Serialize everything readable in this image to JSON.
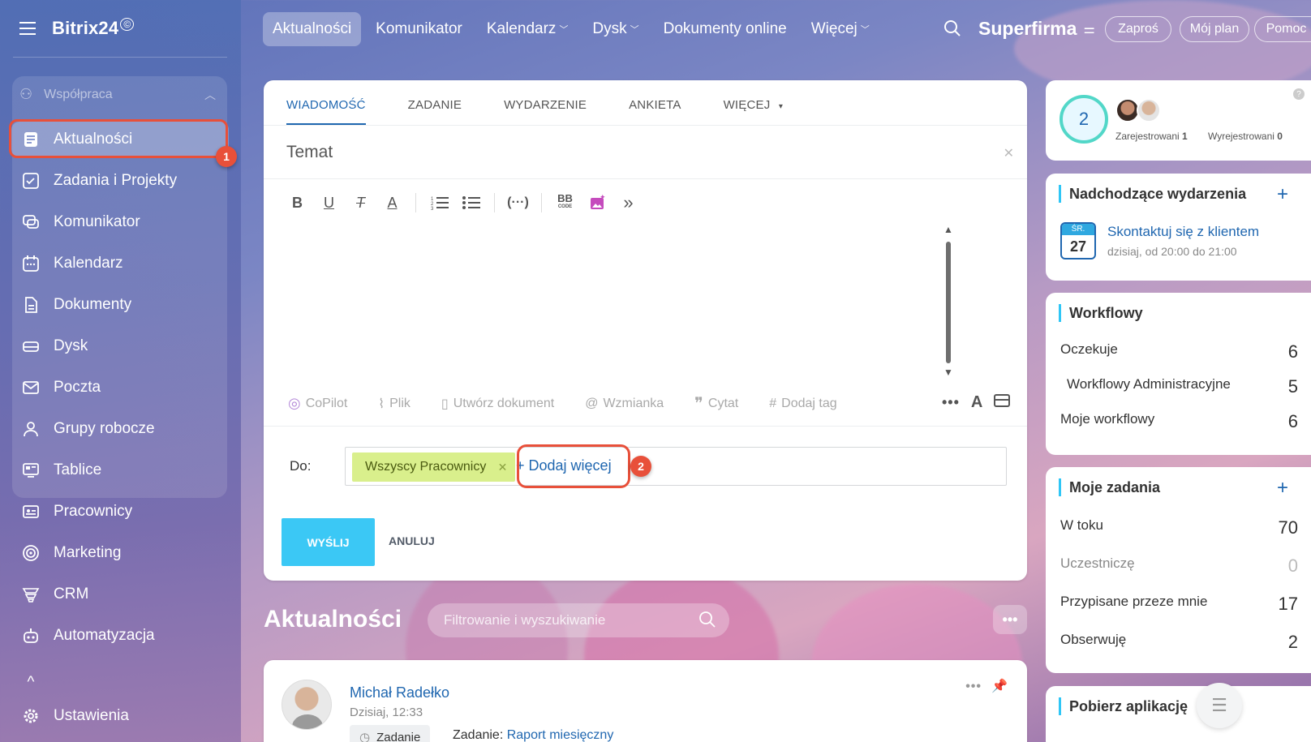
{
  "app": {
    "logo": "Bitrix24",
    "logo_mark": "©",
    "company": "Superfirma"
  },
  "topnav": {
    "items": [
      {
        "label": "Aktualności",
        "active": true
      },
      {
        "label": "Komunikator"
      },
      {
        "label": "Kalendarz",
        "dropdown": true
      },
      {
        "label": "Dysk",
        "dropdown": true
      },
      {
        "label": "Dokumenty online"
      },
      {
        "label": "Więcej",
        "dropdown": true
      }
    ],
    "invite": "Zaproś",
    "plan": "Mój plan",
    "help": "Pomoc"
  },
  "sidebar": {
    "group": "Współpraca",
    "items": [
      {
        "label": "Aktualności",
        "icon": "news-icon",
        "active": true
      },
      {
        "label": "Zadania i Projekty",
        "icon": "tasks-icon"
      },
      {
        "label": "Komunikator",
        "icon": "chat-icon"
      },
      {
        "label": "Kalendarz",
        "icon": "calendar-icon"
      },
      {
        "label": "Dokumenty",
        "icon": "document-icon"
      },
      {
        "label": "Dysk",
        "icon": "drive-icon"
      },
      {
        "label": "Poczta",
        "icon": "mail-icon"
      },
      {
        "label": "Grupy robocze",
        "icon": "groups-icon"
      },
      {
        "label": "Tablice",
        "icon": "boards-icon"
      },
      {
        "label": "Pracownicy",
        "icon": "employees-icon"
      },
      {
        "label": "Marketing",
        "icon": "marketing-icon"
      },
      {
        "label": "CRM",
        "icon": "crm-icon"
      },
      {
        "label": "Automatyzacja",
        "icon": "automation-icon"
      }
    ],
    "settings": "Ustawienia"
  },
  "composer": {
    "tabs": [
      "WIADOMOŚĆ",
      "ZADANIE",
      "WYDARZENIE",
      "ANKIETA",
      "WIĘCEJ"
    ],
    "subject_placeholder": "Temat",
    "actions": [
      "CoPilot",
      "Plik",
      "Utwórz dokument",
      "Wzmianka",
      "Cytat",
      "Dodaj tag"
    ],
    "to_label": "Do:",
    "recipient": "Wszyscy Pracownicy",
    "add_more": "+ Dodaj więcej",
    "send": "WYŚLIJ",
    "cancel": "ANULUJ"
  },
  "annotations": [
    "1",
    "2"
  ],
  "feed": {
    "title": "Aktualności",
    "filter_placeholder": "Filtrowanie i wyszukiwanie",
    "post": {
      "author": "Michał Radełko",
      "time": "Dzisiaj, 12:33",
      "chip": "Zadanie",
      "task_prefix": "Zadanie:",
      "task_name": "Raport miesięczny"
    }
  },
  "widgets": {
    "online": {
      "count": "2",
      "registered_label": "Zarejestrowani",
      "registered": "1",
      "unregistered_label": "Wyrejestrowani",
      "unregistered": "0"
    },
    "events": {
      "title": "Nadchodzące wydarzenia",
      "day_abbr": "ŚR.",
      "day": "27",
      "name": "Skontaktuj się z klientem",
      "when": "dzisiaj, od 20:00 do 21:00"
    },
    "workflows": {
      "title": "Workflowy",
      "rows": [
        {
          "label": "Oczekuje",
          "value": "6"
        },
        {
          "label": "Workflowy Administracyjne",
          "value": "5"
        },
        {
          "label": "Moje workflowy",
          "value": "6"
        }
      ]
    },
    "tasks": {
      "title": "Moje zadania",
      "rows": [
        {
          "label": "W toku",
          "value": "70"
        },
        {
          "label": "Uczestniczę",
          "value": "0"
        },
        {
          "label": "Przypisane przeze mnie",
          "value": "17"
        },
        {
          "label": "Obserwuję",
          "value": "2"
        }
      ]
    },
    "apps": {
      "title": "Pobierz aplikację"
    }
  },
  "colors": {
    "accent": "#2067b0",
    "send_button": "#3bc8f5",
    "highlight": "#e8503a",
    "recipient_tag": "#d9ef8c"
  }
}
